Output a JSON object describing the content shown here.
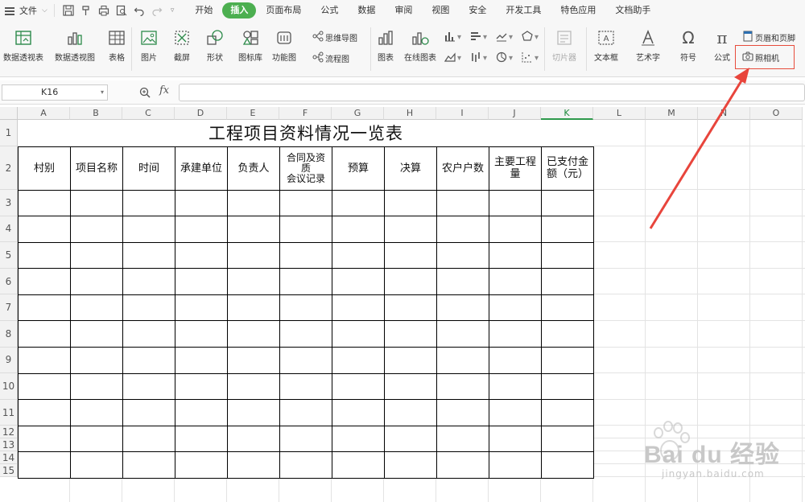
{
  "menubar": {
    "file_label": "文件",
    "tabs": [
      {
        "label": "开始"
      },
      {
        "label": "插入"
      },
      {
        "label": "页面布局"
      },
      {
        "label": "公式"
      },
      {
        "label": "数据"
      },
      {
        "label": "审阅"
      },
      {
        "label": "视图"
      },
      {
        "label": "安全"
      },
      {
        "label": "开发工具"
      },
      {
        "label": "特色应用"
      },
      {
        "label": "文档助手"
      }
    ],
    "active_tab": "插入"
  },
  "ribbon": {
    "pivot_table": "数据透视表",
    "pivot_chart": "数据透视图",
    "table": "表格",
    "picture": "图片",
    "screenshot": "截屏",
    "shapes": "形状",
    "icon_library": "图标库",
    "function_chart": "功能图",
    "mind_map": "思维导图",
    "flowchart": "流程图",
    "chart": "图表",
    "online_chart": "在线图表",
    "slicer": "切片器",
    "textbox": "文本框",
    "wordart": "艺术字",
    "symbol": "符号",
    "formula": "公式",
    "header_footer": "页眉和页脚",
    "camera": "照相机"
  },
  "formula_bar": {
    "name_box": "K16",
    "fx_label": "fx",
    "formula": ""
  },
  "sheet": {
    "columns": [
      "A",
      "B",
      "C",
      "D",
      "E",
      "F",
      "G",
      "H",
      "I",
      "J",
      "K",
      "L",
      "M",
      "N",
      "O"
    ],
    "selected_column": "K",
    "rows": [
      "1",
      "2",
      "3",
      "4",
      "5",
      "6",
      "7",
      "8",
      "9",
      "10",
      "11",
      "12",
      "13",
      "14",
      "15"
    ],
    "table_title": "工程项目资料情况一览表",
    "headers": [
      "村别",
      "项目名称",
      "时间",
      "承建单位",
      "负责人",
      "合同及资质会议记录",
      "预算",
      "决算",
      "农户户数",
      "主要工程量",
      "已支付金额（元）"
    ],
    "header_f_lines": [
      "合同及资",
      "质",
      "会议记录"
    ],
    "header_k_lines": [
      "已支付金",
      "额（元）"
    ],
    "body_row_count": 11
  },
  "colors": {
    "active_tab": "#4caf50",
    "highlight_border": "#e74c3c",
    "arrow": "#e8453c"
  },
  "watermark": {
    "brand": "Bai du 经验",
    "url": "jingyan.baidu.com"
  }
}
